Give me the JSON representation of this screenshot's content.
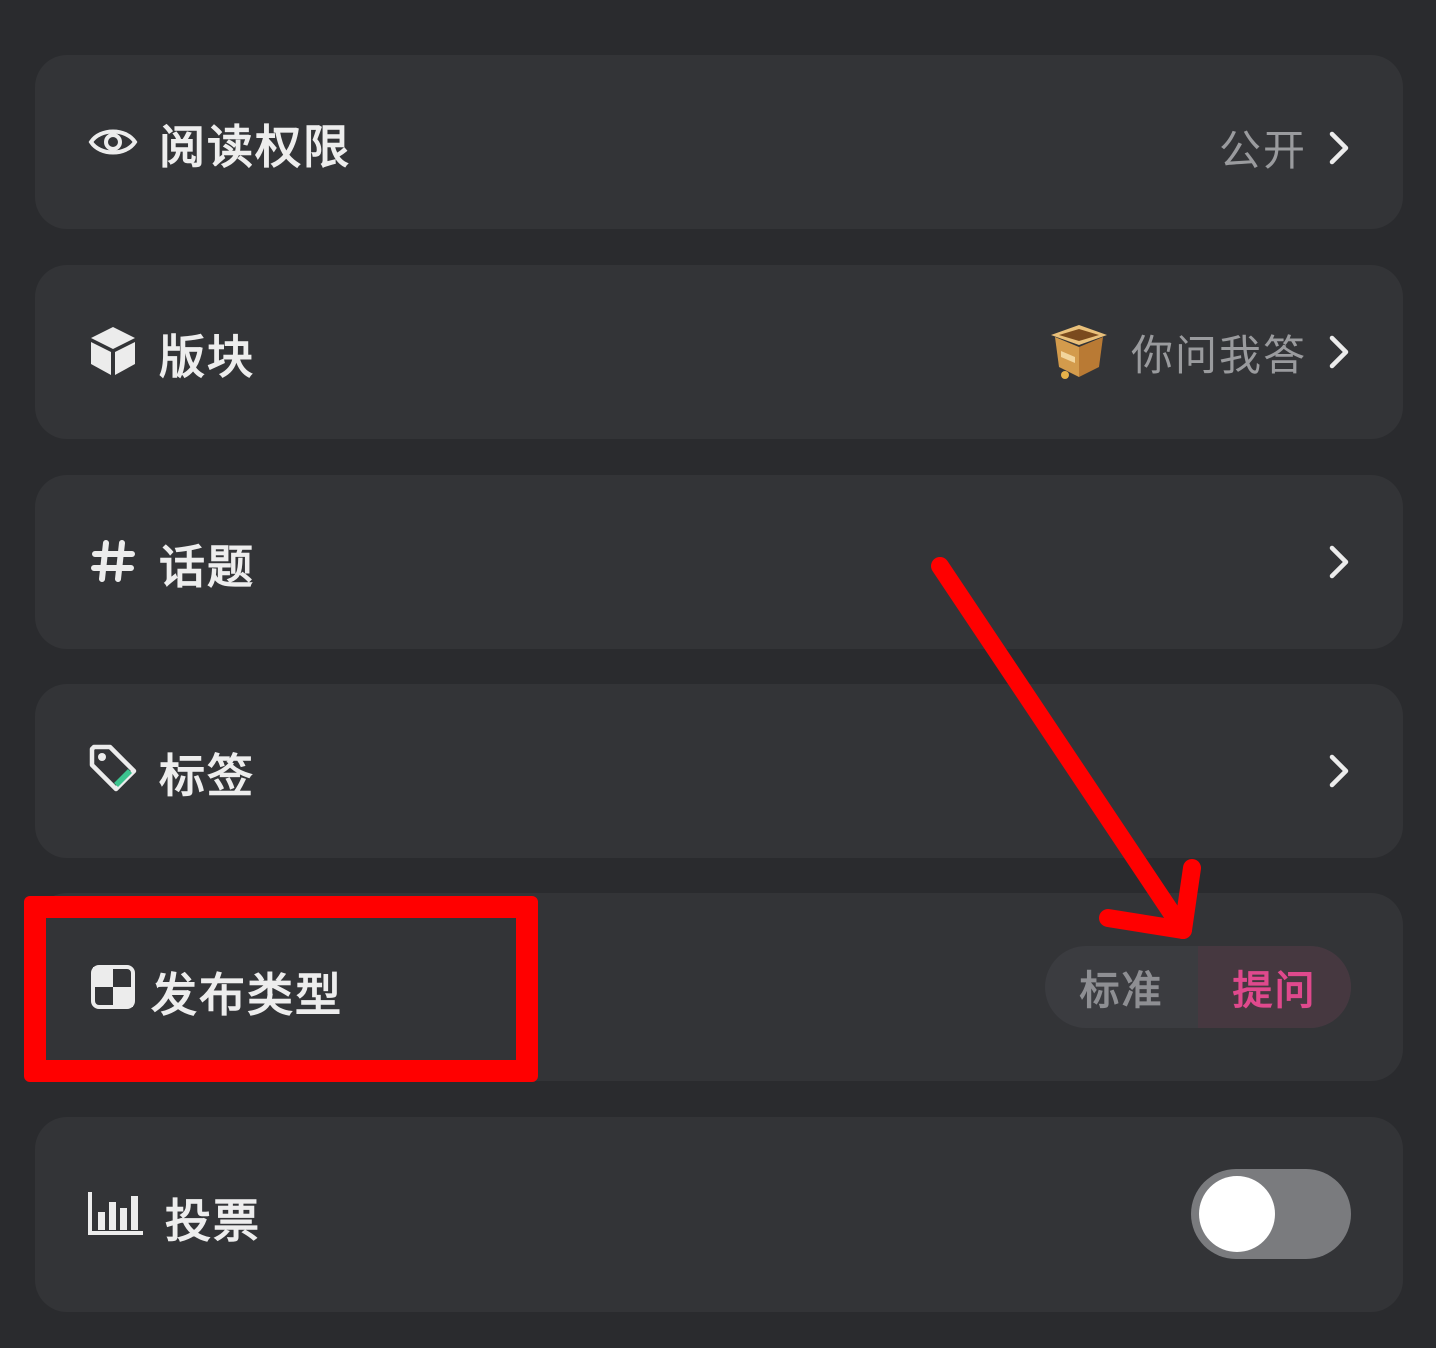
{
  "rows": {
    "read_permission": {
      "label": "阅读权限",
      "value": "公开",
      "icon": "eye-icon"
    },
    "section": {
      "label": "版块",
      "value": "你问我答",
      "icon": "cube-icon",
      "thumbnail_icon": "treasure-box-icon"
    },
    "topic": {
      "label": "话题",
      "icon": "hash-icon"
    },
    "tags": {
      "label": "标签",
      "icon": "tag-icon"
    },
    "post_type": {
      "label": "发布类型",
      "icon": "quadrant-icon",
      "options": [
        "标准",
        "提问"
      ],
      "selected": "提问"
    },
    "vote": {
      "label": "投票",
      "icon": "bar-chart-icon",
      "enabled": false
    }
  },
  "colors": {
    "background": "#2a2b2e",
    "card": "#333437",
    "accent_pink": "#e0498d",
    "annotation_red": "#ff0000",
    "tag_green": "#3cc48f"
  }
}
